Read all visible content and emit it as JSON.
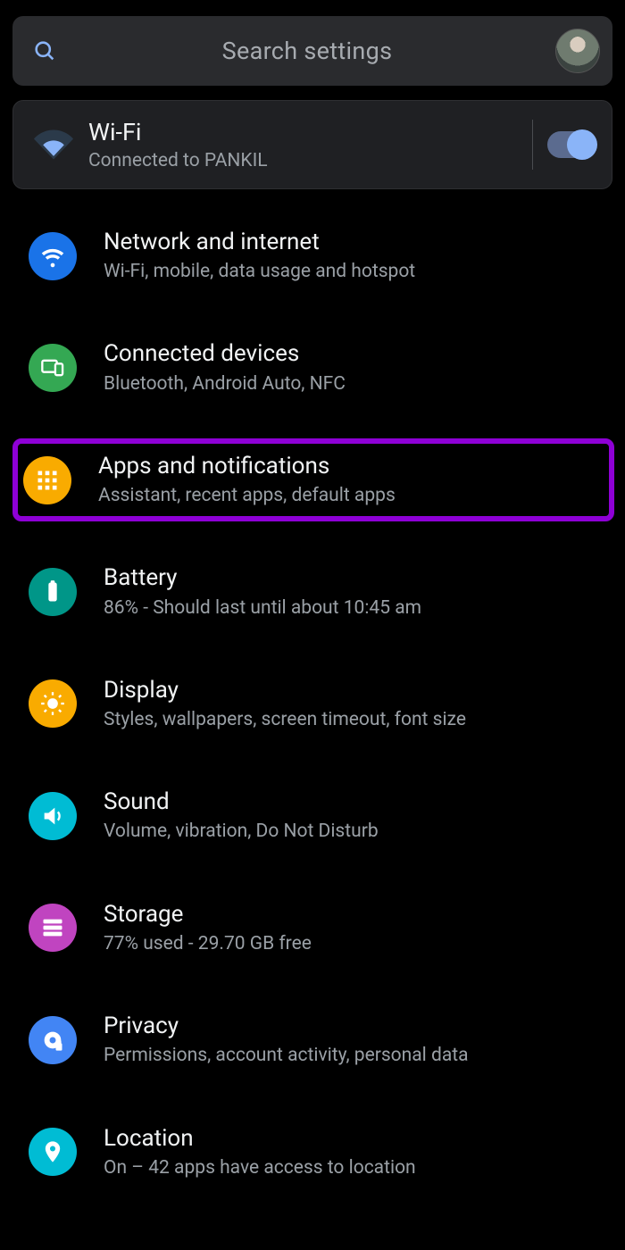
{
  "search": {
    "placeholder": "Search settings"
  },
  "wifi_panel": {
    "title": "Wi-Fi",
    "subtitle": "Connected to PANKIL",
    "toggle_on": true
  },
  "items": [
    {
      "title": "Network and internet",
      "subtitle": "Wi-Fi, mobile, data usage and hotspot",
      "color": "#1a73e8",
      "icon": "wifi"
    },
    {
      "title": "Connected devices",
      "subtitle": "Bluetooth, Android Auto, NFC",
      "color": "#34a853",
      "icon": "devices"
    },
    {
      "title": "Apps and notifications",
      "subtitle": "Assistant, recent apps, default apps",
      "color": "#f9ab00",
      "icon": "apps",
      "highlight": true
    },
    {
      "title": "Battery",
      "subtitle": "86% - Should last until about 10:45 am",
      "color": "#009688",
      "icon": "battery"
    },
    {
      "title": "Display",
      "subtitle": "Styles, wallpapers, screen timeout, font size",
      "color": "#f9ab00",
      "icon": "brightness"
    },
    {
      "title": "Sound",
      "subtitle": "Volume, vibration, Do Not Disturb",
      "color": "#00bcd4",
      "icon": "sound"
    },
    {
      "title": "Storage",
      "subtitle": "77% used - 29.70 GB free",
      "color": "#c044c0",
      "icon": "storage"
    },
    {
      "title": "Privacy",
      "subtitle": "Permissions, account activity, personal data",
      "color": "#4285f4",
      "icon": "privacy"
    },
    {
      "title": "Location",
      "subtitle": "On – 42 apps have access to location",
      "color": "#00bcd4",
      "icon": "location"
    }
  ]
}
